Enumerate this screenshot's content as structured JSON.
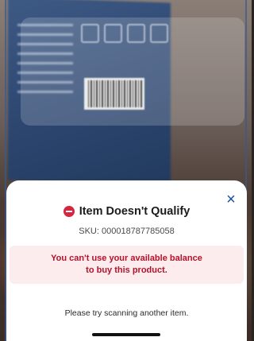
{
  "sheet": {
    "title": "Item Doesn't Qualify",
    "sku": "SKU: 000018787785058",
    "alert_message": "You can't use your available balance to buy this product.",
    "hint": "Please try scanning another item.",
    "close_icon": "×"
  },
  "icons": {
    "status": "no-entry-icon",
    "close": "close-icon"
  },
  "colors": {
    "alert_red": "#d7263d",
    "alert_bg": "#fdecee",
    "close_blue": "#1a4fa8"
  }
}
